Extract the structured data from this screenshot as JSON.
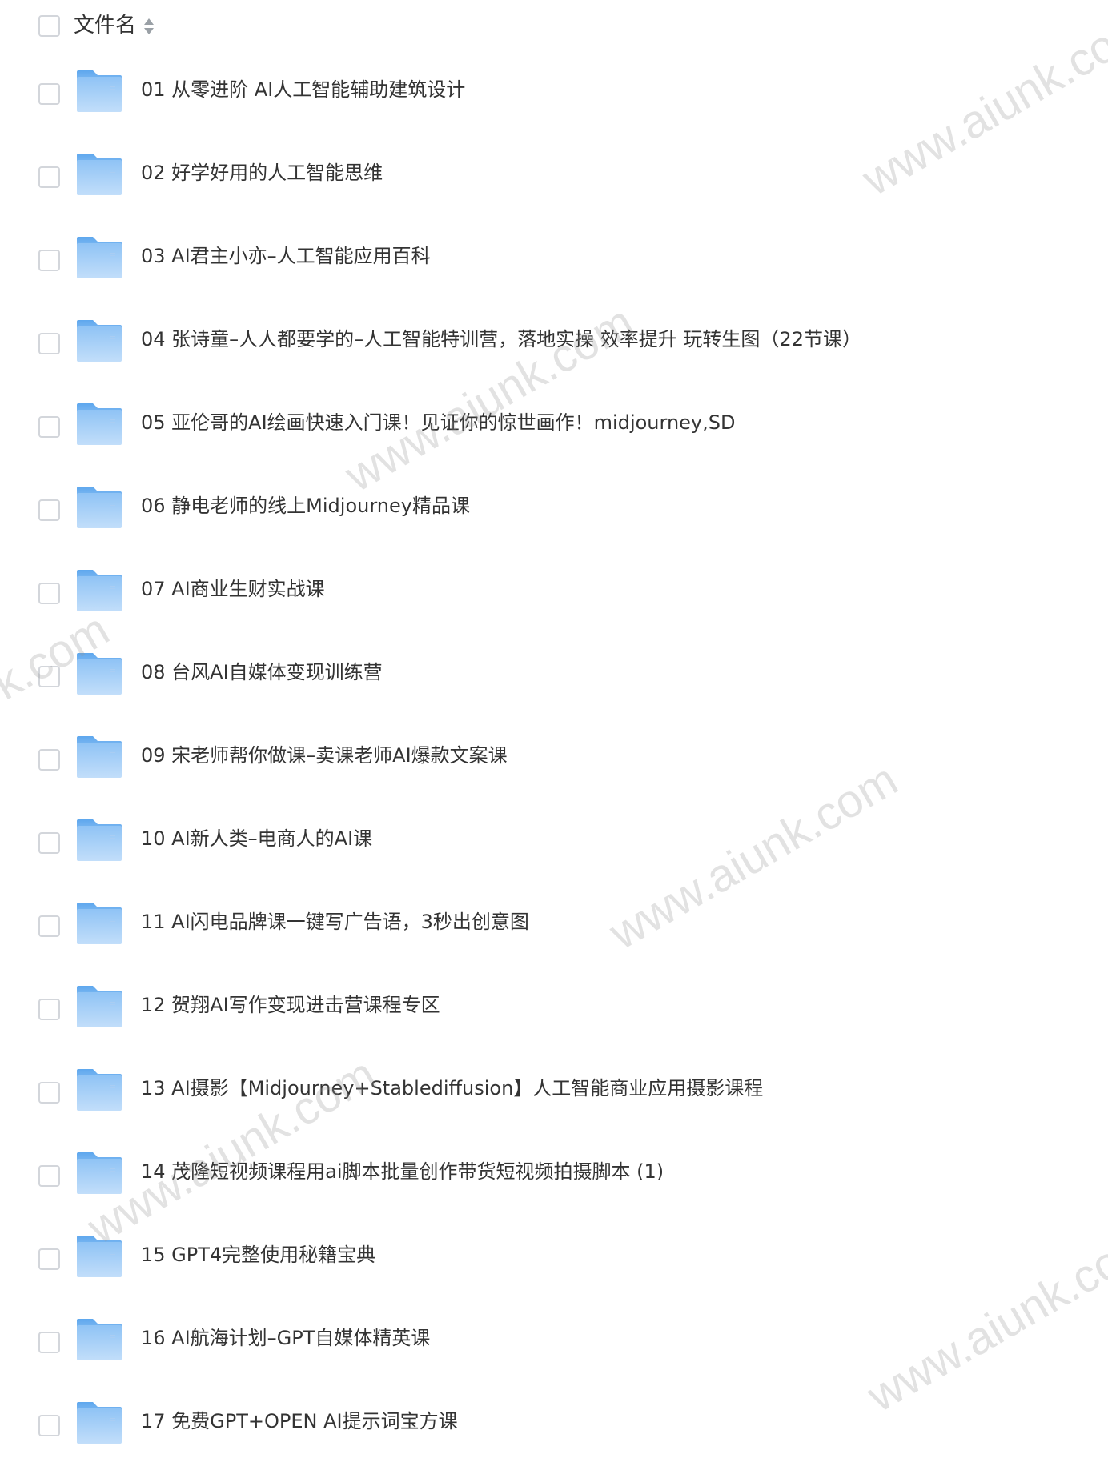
{
  "header": {
    "column_label": "文件名",
    "sort_icon": "sort-icon"
  },
  "files": [
    {
      "name": "01 从零进阶 AI人工智能辅助建筑设计",
      "icon": "folder-icon"
    },
    {
      "name": "02 好学好用的人工智能思维",
      "icon": "folder-icon"
    },
    {
      "name": "03 AI君主小亦–人工智能应用百科",
      "icon": "folder-icon"
    },
    {
      "name": "04 张诗童–人人都要学的–人工智能特训营，落地实操 效率提升 玩转生图（22节课）",
      "icon": "folder-icon"
    },
    {
      "name": "05 亚伦哥的AI绘画快速入门课！见证你的惊世画作！midjourney,SD",
      "icon": "folder-icon"
    },
    {
      "name": "06 静电老师的线上Midjourney精品课",
      "icon": "folder-icon"
    },
    {
      "name": "07 AI商业生财实战课",
      "icon": "folder-icon"
    },
    {
      "name": "08 台风AI自媒体变现训练营",
      "icon": "folder-icon"
    },
    {
      "name": "09 宋老师帮你做课–卖课老师AI爆款文案课",
      "icon": "folder-icon"
    },
    {
      "name": "10 AI新人类–电商人的AI课",
      "icon": "folder-icon"
    },
    {
      "name": "11 AI闪电品牌课一键写广告语，3秒出创意图",
      "icon": "folder-icon"
    },
    {
      "name": "12 贺翔AI写作变现进击营课程专区",
      "icon": "folder-icon"
    },
    {
      "name": "13 AI摄影【Midjourney+Stablediffusion】人工智能商业应用摄影课程",
      "icon": "folder-icon"
    },
    {
      "name": "14 茂隆短视频课程用ai脚本批量创作带货短视频拍摄脚本 (1)",
      "icon": "folder-icon"
    },
    {
      "name": "15 GPT4完整使用秘籍宝典",
      "icon": "folder-icon"
    },
    {
      "name": "16 AI航海计划–GPT自媒体精英课",
      "icon": "folder-icon"
    },
    {
      "name": "17 免费GPT+OPEN AI提示词宝方课",
      "icon": "folder-icon"
    }
  ],
  "watermarks": [
    "www.aiunk.com",
    "www.aiunk.com",
    "www.aiunk.com",
    "www.aiunk.com",
    "www.aiunk.com",
    "k.com"
  ]
}
